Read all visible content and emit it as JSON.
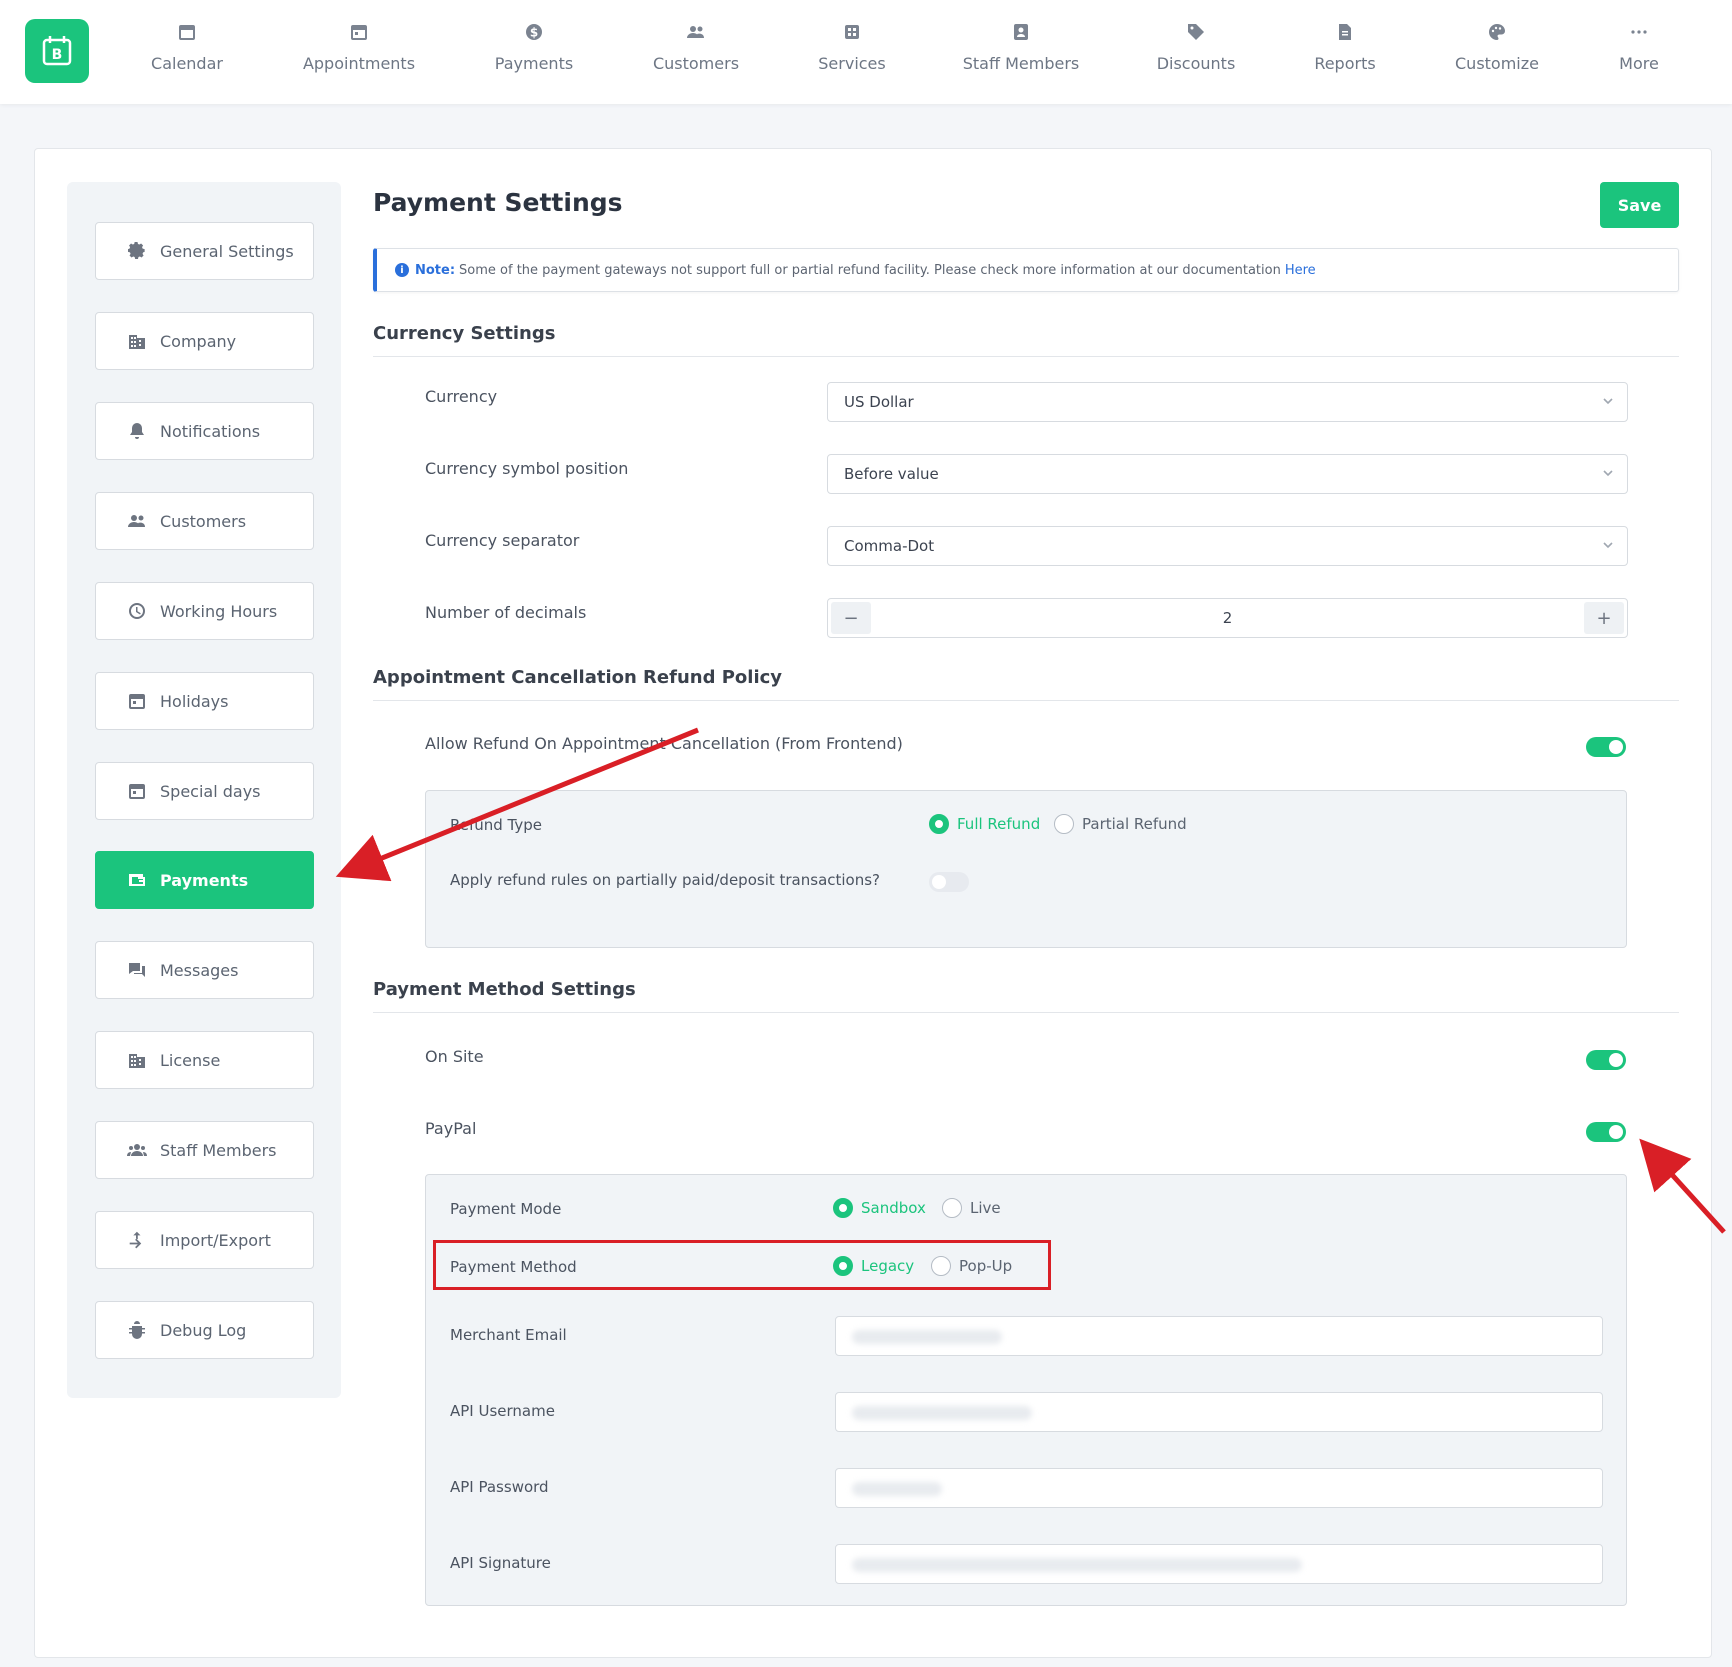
{
  "nav": {
    "items": [
      {
        "label": "Calendar",
        "icon": "calendar-icon"
      },
      {
        "label": "Appointments",
        "icon": "appointments-icon"
      },
      {
        "label": "Payments",
        "icon": "dollar-icon"
      },
      {
        "label": "Customers",
        "icon": "users-icon"
      },
      {
        "label": "Services",
        "icon": "services-icon"
      },
      {
        "label": "Staff Members",
        "icon": "staff-icon"
      },
      {
        "label": "Discounts",
        "icon": "tag-icon"
      },
      {
        "label": "Reports",
        "icon": "reports-icon"
      },
      {
        "label": "Customize",
        "icon": "palette-icon"
      },
      {
        "label": "More",
        "icon": "ellipsis-icon"
      }
    ]
  },
  "sidebar": {
    "items": [
      {
        "label": "General Settings",
        "icon": "gear-icon"
      },
      {
        "label": "Company",
        "icon": "building-icon"
      },
      {
        "label": "Notifications",
        "icon": "bell-icon"
      },
      {
        "label": "Customers",
        "icon": "users-icon"
      },
      {
        "label": "Working Hours",
        "icon": "clock-icon"
      },
      {
        "label": "Holidays",
        "icon": "calendar-icon"
      },
      {
        "label": "Special days",
        "icon": "calendar-icon"
      },
      {
        "label": "Payments",
        "icon": "wallet-icon",
        "active": true
      },
      {
        "label": "Messages",
        "icon": "chat-icon"
      },
      {
        "label": "License",
        "icon": "building-icon"
      },
      {
        "label": "Staff Members",
        "icon": "users-icon"
      },
      {
        "label": "Import/Export",
        "icon": "import-export-icon"
      },
      {
        "label": "Debug Log",
        "icon": "bug-icon"
      }
    ]
  },
  "page": {
    "title": "Payment Settings",
    "save_label": "Save",
    "note": {
      "prefix": "Note:",
      "text": "Some of the payment gateways not support full or partial refund facility. Please check more information at our documentation",
      "link": "Here"
    }
  },
  "currency": {
    "title": "Currency Settings",
    "currency_label": "Currency",
    "currency_value": "US Dollar",
    "position_label": "Currency symbol position",
    "position_value": "Before value",
    "separator_label": "Currency separator",
    "separator_value": "Comma-Dot",
    "decimals_label": "Number of decimals",
    "decimals_value": "2",
    "minus": "−",
    "plus": "+"
  },
  "refund": {
    "title": "Appointment Cancellation Refund Policy",
    "allow_label": "Allow Refund On Appointment Cancellation (From Frontend)",
    "allow_enabled": true,
    "type_label": "Refund Type",
    "full_label": "Full Refund",
    "partial_label": "Partial Refund",
    "selected": "Full Refund",
    "apply_label": "Apply refund rules on partially paid/deposit transactions?",
    "apply_enabled": false
  },
  "methods": {
    "title": "Payment Method Settings",
    "onsite_label": "On Site",
    "onsite_enabled": true,
    "paypal_label": "PayPal",
    "paypal_enabled": true,
    "mode_label": "Payment Mode",
    "mode_sandbox": "Sandbox",
    "mode_live": "Live",
    "mode_selected": "Sandbox",
    "method_label": "Payment Method",
    "method_legacy": "Legacy",
    "method_popup": "Pop-Up",
    "method_selected": "Legacy",
    "merchant_email_label": "Merchant Email",
    "api_username_label": "API Username",
    "api_password_label": "API Password",
    "api_signature_label": "API Signature"
  },
  "colors": {
    "accent": "#1bc47d",
    "info": "#2a6fdb",
    "annotation": "#d91f26"
  }
}
